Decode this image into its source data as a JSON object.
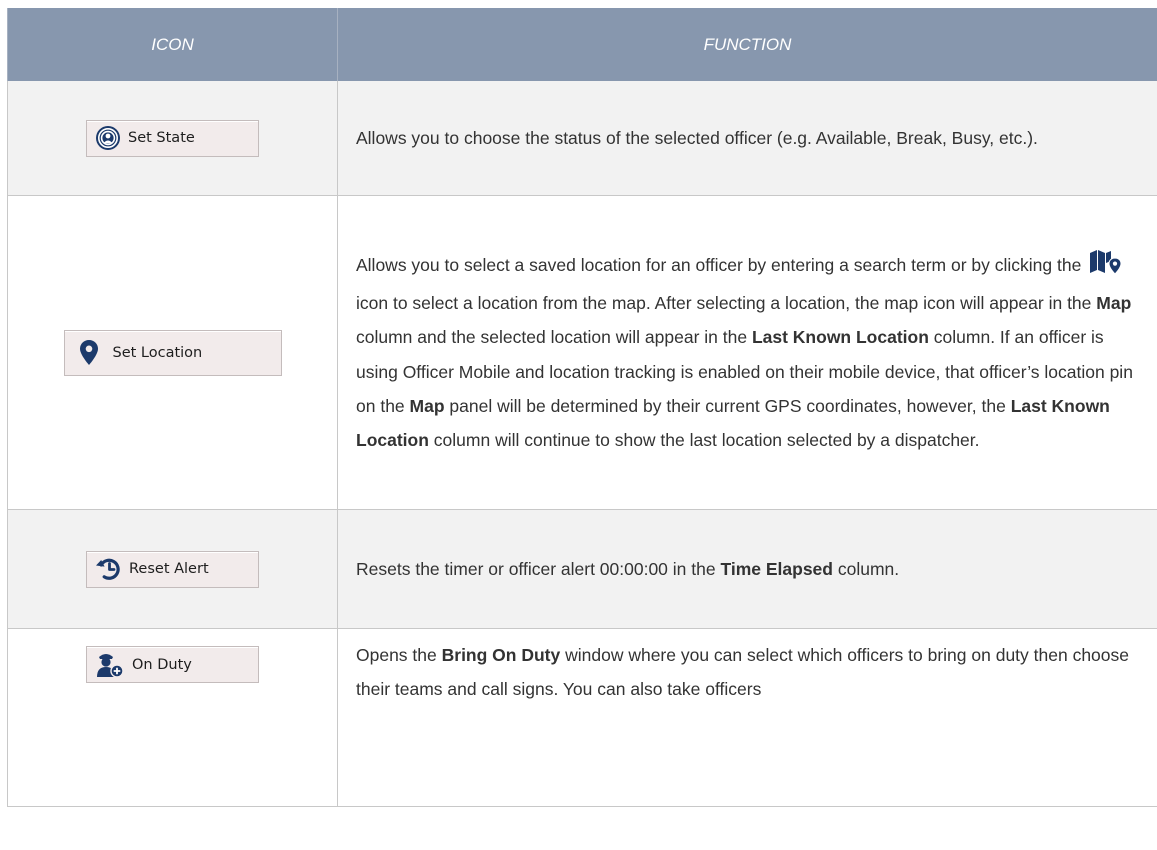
{
  "table": {
    "headers": {
      "icon": "ICON",
      "function": "FUNCTION"
    },
    "rows": [
      {
        "button_label": "Set State",
        "icon": "broadcast-person-icon",
        "description": "Allows you to choose the status of the selected officer (e.g. Available, Break, Busy, etc.)."
      },
      {
        "button_label": "Set Location",
        "icon": "map-pin-icon",
        "description": {
          "p1": "Allows you to select a saved location for an officer by entering a search term or by clicking the",
          "inline_icon": "folded-map-pin-icon",
          "p2": "icon to select a location from the map. After selecting a location, the map icon will appear in the",
          "b1": "Map",
          "p3": "column and the selected location will appear in the",
          "b2": "Last Known Location",
          "p4": "column. If an officer is using Officer Mobile and location tracking is enabled on their mobile device, that officer’s location pin on the",
          "b3": "Map",
          "p5": "panel will be determined by their current GPS coordinates, however, the",
          "b4": "Last Known Location",
          "p6": "column will continue to show the last location selected by a dispatcher."
        }
      },
      {
        "button_label": "Reset Alert",
        "icon": "history-reset-icon",
        "description": {
          "p1": "Resets the timer or officer alert 00:00:00 in the",
          "b1": "Time Elapsed",
          "p2": "column."
        }
      },
      {
        "button_label": "On Duty",
        "icon": "officer-add-icon",
        "description": {
          "p1": "Opens the",
          "b1": "Bring On Duty",
          "p2": "window where you can select which officers to bring on duty then choose their teams and call signs. You can also take officers"
        }
      }
    ]
  },
  "colors": {
    "header_bg": "#8797ae",
    "icon_blue": "#1c3a6b",
    "button_bg": "#f2ebeb",
    "row_alt_bg": "#f2f2f2"
  }
}
